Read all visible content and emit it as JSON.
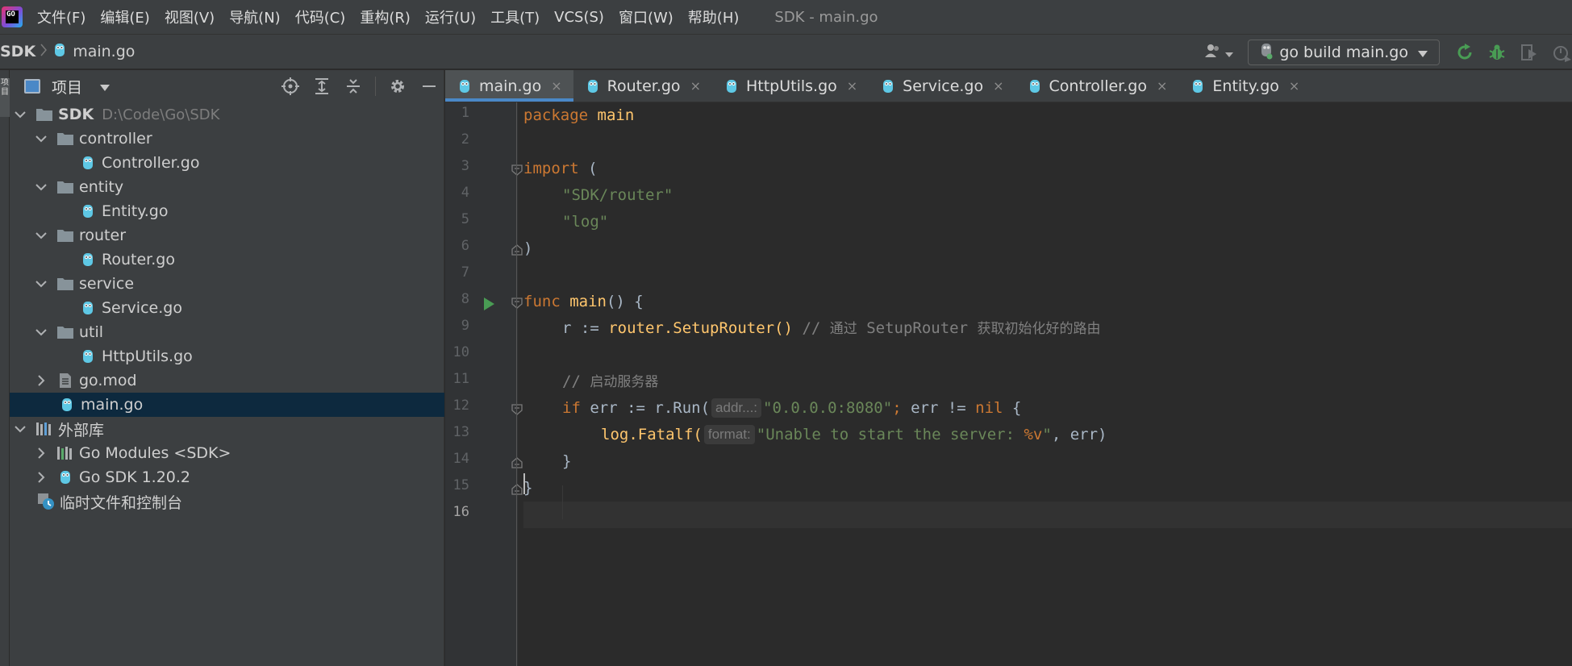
{
  "app": {
    "logo_text": "GO",
    "window_title": "SDK - main.go",
    "menu": [
      "文件(F)",
      "编辑(E)",
      "视图(V)",
      "导航(N)",
      "代码(C)",
      "重构(R)",
      "运行(U)",
      "工具(T)",
      "VCS(S)",
      "窗口(W)",
      "帮助(H)"
    ]
  },
  "navbar": {
    "project": "SDK",
    "file": "main.go",
    "run_config": "go build main.go"
  },
  "left_strip": {
    "label": "项目"
  },
  "project_panel": {
    "title": "项目",
    "tree": [
      {
        "label": "SDK",
        "path": "D:\\Code\\Go\\SDK"
      },
      {
        "label": "controller"
      },
      {
        "label": "Controller.go"
      },
      {
        "label": "entity"
      },
      {
        "label": "Entity.go"
      },
      {
        "label": "router"
      },
      {
        "label": "Router.go"
      },
      {
        "label": "service"
      },
      {
        "label": "Service.go"
      },
      {
        "label": "util"
      },
      {
        "label": "HttpUtils.go"
      },
      {
        "label": "go.mod"
      },
      {
        "label": "main.go"
      },
      {
        "label": "外部库"
      },
      {
        "label": "Go Modules <SDK>"
      },
      {
        "label": "Go SDK 1.20.2"
      },
      {
        "label": "临时文件和控制台"
      }
    ]
  },
  "tabs": [
    "main.go",
    "Router.go",
    "HttpUtils.go",
    "Service.go",
    "Controller.go",
    "Entity.go"
  ],
  "tab_close": "×",
  "line_numbers": [
    "1",
    "2",
    "3",
    "4",
    "5",
    "6",
    "7",
    "8",
    "9",
    "10",
    "11",
    "12",
    "13",
    "14",
    "15",
    "16"
  ],
  "code": {
    "l1_kw": "package",
    "l1_name": "main",
    "l3_kw": "import",
    "l3_paren": " (",
    "l4_str": "\"SDK/router\"",
    "l5_str": "\"log\"",
    "l6": ")",
    "l8_kw": "func",
    "l8_fn": "main",
    "l8_rest": "() {",
    "l9_a": "r := ",
    "l9_pkg": "router",
    "l9_b": ".SetupRouter()",
    "l9_cmt_a": " // ",
    "l9_cmt_b": "通过",
    "l9_cmt_c": " SetupRouter ",
    "l9_cmt_d": "获取初始化好的路由",
    "l11_cmt_a": "// ",
    "l11_cmt_b": "启动服务器",
    "l12_kw": "if",
    "l12_a": " err := r.Run(",
    "l12_hint": "addr...:",
    "l12_str": "\"0.0.0.0:8080\"",
    "l12_semi": ";",
    "l12_b": " err != ",
    "l12_nil": "nil",
    "l12_c": " {",
    "l13_a": "log.Fatalf(",
    "l13_hint": "format:",
    "l13_str_a": "\"Unable to start the server: ",
    "l13_fmt": "%v",
    "l13_str_b": "\"",
    "l13_b": ", err)",
    "l14": "}",
    "l15": "}"
  },
  "colors": {
    "keyword": "#cc7832",
    "function": "#ffc66d",
    "string": "#6a8759",
    "comment": "#808080",
    "accent": "#4a88c7",
    "run_green": "#499c54"
  }
}
